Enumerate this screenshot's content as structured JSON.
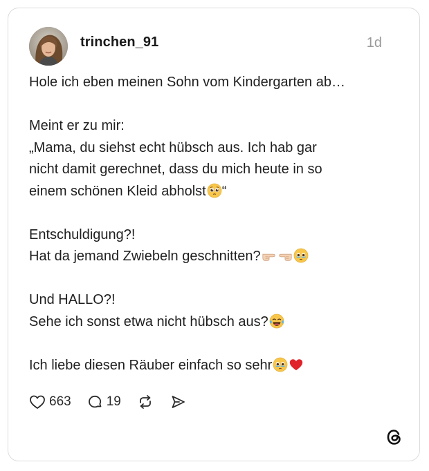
{
  "post": {
    "username": "trinchen_91",
    "time": "1d",
    "lines": {
      "l1": "Hole ich eben meinen Sohn vom Kindergarten ab…",
      "l2": "Meint er zu mir:",
      "l3": "„Mama, du siehst echt hübsch aus. Ich hab gar",
      "l4": "nicht damit gerechnet, dass du mich heute in so",
      "l5a": "einem schönen Kleid abholst",
      "l5b": "“",
      "l6": "Entschuldigung?!",
      "l7": "Hat da jemand Zwiebeln geschnitten?",
      "l8": "Und HALLO?!",
      "l9": "Sehe ich sonst etwa nicht hübsch aus?",
      "l10": "Ich liebe diesen Räuber einfach so sehr"
    },
    "emojis": {
      "pleading": "pleading-face-emoji",
      "pointing_right": "backhand-index-pointing-right-emoji",
      "pointing_left": "backhand-index-pointing-left-emoji",
      "holding_tears": "face-holding-back-tears-emoji",
      "tears_of_joy": "face-with-tears-of-joy-emoji",
      "red_heart": "red-heart-emoji"
    }
  },
  "actions": {
    "likes": "663",
    "replies": "19",
    "icons": [
      "heart-icon",
      "comment-icon",
      "repost-icon",
      "share-icon"
    ]
  },
  "colors": {
    "text": "#1f1f1f",
    "muted": "#9a9a9a",
    "border": "#dcdcdc",
    "emoji_yellow": "#f7c64b",
    "heart_red": "#e0222b"
  },
  "branding": {
    "logo": "threads-logo-icon"
  }
}
